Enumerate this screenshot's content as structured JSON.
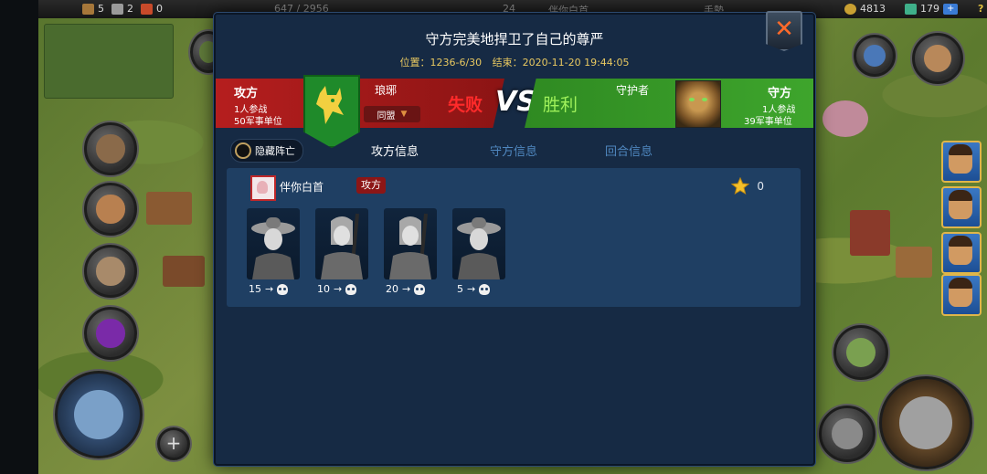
{
  "topbar": {
    "res1": "5",
    "res2": "2",
    "res3": "0",
    "res4": "647 / 2956",
    "res5": "24",
    "player_tag": "伴你白首",
    "res6": "手勢",
    "gold": "4813",
    "gems": "179",
    "plus": "+",
    "help": "?"
  },
  "dialog": {
    "title": "守方完美地捍卫了自己的尊严",
    "location_label": "位置：1236-6/30",
    "end_label": "结束：2020-11-20 19:44:05",
    "close_symbol": "✕"
  },
  "attacker": {
    "title": "攻方",
    "participants": "1人参战",
    "units": "50军事单位",
    "alliance_name": "琅琊",
    "alliance_tag": "同盟",
    "result": "失败",
    "color": "#b51e1e"
  },
  "vs_label": "VS",
  "defender": {
    "title": "守方",
    "participants": "1人参战",
    "units": "39军事单位",
    "name": "守护者",
    "result": "胜利",
    "color": "#2f8a22"
  },
  "tabs": {
    "hide_dead": "隐藏阵亡",
    "attacker_info": "攻方信息",
    "defender_info": "守方信息",
    "round_info": "回合信息"
  },
  "report": {
    "player_name": "伴你白首",
    "role": "攻方",
    "stars": "0",
    "arrow": "→",
    "units": [
      {
        "type": "hat-soldier",
        "count": "15"
      },
      {
        "type": "spearman",
        "count": "10"
      },
      {
        "type": "spearman",
        "count": "20"
      },
      {
        "type": "hat-soldier",
        "count": "5"
      }
    ]
  }
}
